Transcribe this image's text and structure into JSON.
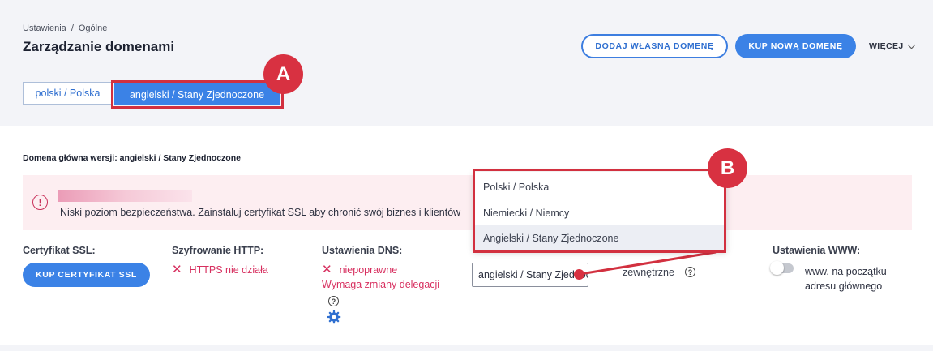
{
  "breadcrumb": {
    "parent": "Ustawienia",
    "separator": "/",
    "current": "Ogólne"
  },
  "page": {
    "title": "Zarządzanie domenami"
  },
  "header_actions": {
    "add_own_domain": "DODAJ WŁASNĄ DOMENĘ",
    "buy_new_domain": "KUP NOWĄ DOMENĘ",
    "more": "WIĘCEJ"
  },
  "language_tabs": [
    {
      "label": "polski / Polska",
      "active": false
    },
    {
      "label": "angielski / Stany Zjednoczone",
      "active": true
    }
  ],
  "annotations": {
    "a": "A",
    "b": "B"
  },
  "main_domain_label": "Domena główna wersji: angielski / Stany Zjednoczone",
  "alert": {
    "text": "Niski poziom bezpieczeństwa. Zainstaluj certyfikat SSL aby chronić swój biznes i klientów"
  },
  "ssl": {
    "label": "Certyfikat SSL:",
    "button": "KUP CERTYFIKAT SSL"
  },
  "http": {
    "label": "Szyfrowanie HTTP:",
    "status": "HTTPS nie działa"
  },
  "dns": {
    "label": "Ustawienia DNS:",
    "status": "niepoprawne",
    "sub": "Wymaga zmiany delegacji"
  },
  "language_select": {
    "value": "angielski / Stany Zjednoczone",
    "options": [
      "Polski / Polska",
      "Niemiecki / Niemcy",
      "Angielski / Stany Zjednoczone"
    ],
    "selected_index": 2
  },
  "external": {
    "text": "zewnętrzne"
  },
  "www": {
    "label": "Ustawienia WWW:",
    "toggle_text": "www. na początku adresu głównego",
    "enabled": false
  },
  "colors": {
    "primary": "#3b82e6",
    "highlight": "#d2303f",
    "error": "#d72f5f",
    "alert_bg": "#fdeef1"
  }
}
